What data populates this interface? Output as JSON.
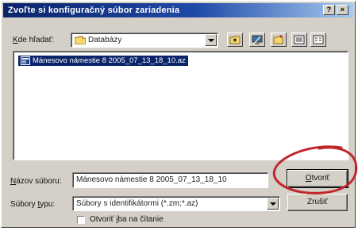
{
  "window": {
    "title": "Zvoľte si konfiguračný súbor zariadenia",
    "help_button": "?",
    "close_button": "×"
  },
  "lookin": {
    "label_prefix": "",
    "label_hotkey": "K",
    "label_rest": "de hľadať:",
    "value": "Databázy",
    "icon": "folder-icon"
  },
  "toolbar": {
    "icons": [
      "up-folder-icon",
      "desktop-icon",
      "new-folder-icon",
      "list-view-icon",
      "details-view-icon"
    ]
  },
  "files": [
    {
      "name": "Mánesovo námestie 8 2005_07_13_18_10.az",
      "selected": true,
      "icon": "file-icon"
    }
  ],
  "filename": {
    "label_prefix": "",
    "label_hotkey": "N",
    "label_rest": "ázov súboru:",
    "value": "Mánesovo námestie 8 2005_07_13_18_10"
  },
  "filetype": {
    "label_prefix": "Súbory ",
    "label_hotkey": "t",
    "label_rest": "ypu:",
    "value": "Súbory s identifikátormi (*.zm;*.az)"
  },
  "buttons": {
    "open_prefix": "",
    "open_hotkey": "O",
    "open_rest": "tvoriť",
    "cancel": "Zrušiť"
  },
  "readonly": {
    "label_prefix": "Otvoriť ",
    "label_hotkey": "i",
    "label_rest": "ba na čítanie",
    "checked": false
  },
  "colors": {
    "title_start": "#0a246a",
    "title_end": "#a6caf0",
    "dialog_face": "#d4d0c8",
    "selection": "#0a246a",
    "annotation_circle": "#c0262c"
  }
}
